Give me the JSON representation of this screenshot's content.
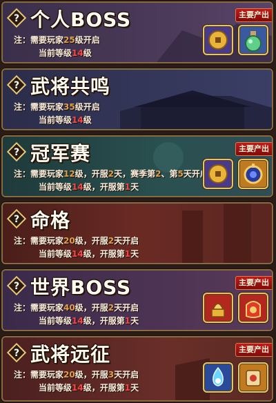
{
  "cards": [
    {
      "title": "个人BOSS",
      "note_prefix": "注：",
      "line1": {
        "a": "需要玩家",
        "lv": "25",
        "b": "级开启",
        "c": "",
        "d": "",
        "e": "",
        "f": ""
      },
      "line2": {
        "a": "当前等级",
        "lv": "14",
        "b": "级",
        "c": "",
        "d": "",
        "e": ""
      },
      "tag": "主要产出",
      "items": [
        "coin-icon",
        "potion-icon"
      ]
    },
    {
      "title": "武将共鸣",
      "note_prefix": "注：",
      "line1": {
        "a": "需要玩家",
        "lv": "35",
        "b": "级开启"
      },
      "line2": {
        "a": "当前等级",
        "lv": "14",
        "b": "级"
      }
    },
    {
      "title": "冠军赛",
      "note_prefix": "注：",
      "line1": {
        "a": "需要玩家",
        "lv": "12",
        "b": "级，开服",
        "d": "2",
        "e": "天，赛季第",
        "f": "2",
        "g": "、第",
        "h": "5",
        "i": "天开启"
      },
      "line2": {
        "a": "当前等级",
        "lv": "14",
        "b": "级，开服第",
        "d": "1",
        "e": "天"
      },
      "tag": "主要产出",
      "items": [
        "coin-icon",
        "amulet-icon"
      ]
    },
    {
      "title": "命格",
      "note_prefix": "注：",
      "line1": {
        "a": "需要玩家",
        "lv": "20",
        "b": "级，开服",
        "d": "2",
        "e": "天开启"
      },
      "line2": {
        "a": "当前等级",
        "lv": "14",
        "b": "级，开服第",
        "d": "1",
        "e": "天"
      }
    },
    {
      "title": "世界BOSS",
      "note_prefix": "注：",
      "line1": {
        "a": "需要玩家",
        "lv": "40",
        "b": "级，开服",
        "d": "2",
        "e": "天开启"
      },
      "line2": {
        "a": "当前等级",
        "lv": "14",
        "b": "级，开服第",
        "d": "1",
        "e": "天"
      },
      "tag": "主要产出",
      "items": [
        "golden-seal-icon",
        "red-bag-icon"
      ]
    },
    {
      "title": "武将远征",
      "note_prefix": "注：",
      "line1": {
        "a": "需要玩家",
        "lv": "20",
        "b": "级，开服",
        "d": "3",
        "e": "天开启"
      },
      "line2": {
        "a": "当前等级",
        "lv": "14",
        "b": "级，开服第",
        "d": "1",
        "e": "天"
      },
      "tag": "主要产出",
      "items": [
        "blue-flame-icon",
        "scroll-icon"
      ]
    }
  ]
}
